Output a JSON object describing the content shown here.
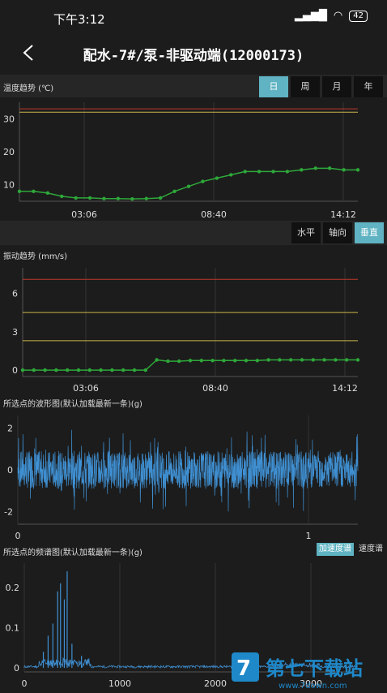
{
  "status_bar": {
    "time": "下午3:12",
    "battery": "42"
  },
  "header": {
    "title": "配水-7#/泵-非驱动端(12000173)"
  },
  "temperature": {
    "label": "温度趋势 (℃)",
    "period_tabs": [
      "日",
      "周",
      "月",
      "年"
    ],
    "active_tab": "日"
  },
  "vibration": {
    "direction_tabs": [
      "水平",
      "轴向",
      "垂直"
    ],
    "active_tab": "垂直",
    "label": "振动趋势 (mm/s)"
  },
  "waveform": {
    "label": "所选点的波形图(默认加载最新一条)(g)"
  },
  "spectrum": {
    "label": "所选点的频谱图(默认加载最新一条)(g)",
    "tabs": [
      "加速度谱",
      "速度谱"
    ],
    "active_tab": "加速度谱"
  },
  "watermark": {
    "text": "第七下载站",
    "url": "www.7down.com"
  },
  "colors": {
    "accent": "#5fb3c2",
    "series_green": "#2ea83a",
    "alarm_red": "#c0392b",
    "alarm_yellow": "#c9b44a",
    "wave_blue": "#3f8fd1"
  },
  "chart_data": [
    {
      "type": "line",
      "name": "temperature-trend",
      "x_tick_labels": [
        "03:06",
        "08:40",
        "14:12"
      ],
      "y_ticks": [
        10,
        20,
        30
      ],
      "ylim": [
        5,
        35
      ],
      "thresholds": [
        33,
        32
      ],
      "series": [
        {
          "values": [
            8,
            8,
            7.5,
            6.5,
            6,
            6,
            5.8,
            5.8,
            5.7,
            5.8,
            6,
            8,
            9.5,
            11,
            12,
            13,
            14,
            14,
            14,
            14,
            14.5,
            15,
            15,
            14.5,
            14.5
          ]
        }
      ]
    },
    {
      "type": "line",
      "name": "vibration-trend",
      "x_tick_labels": [
        "03:06",
        "08:40",
        "14:12"
      ],
      "y_ticks": [
        0,
        3,
        6
      ],
      "ylim": [
        -0.5,
        8
      ],
      "thresholds": [
        7.1,
        4.5,
        2.3
      ],
      "series": [
        {
          "values": [
            0,
            0,
            0,
            0,
            0,
            0,
            0,
            0,
            0,
            0,
            0,
            0,
            0.8,
            0.7,
            0.7,
            0.75,
            0.75,
            0.75,
            0.75,
            0.75,
            0.75,
            0.75,
            0.8,
            0.8,
            0.8,
            0.8,
            0.8,
            0.8,
            0.8,
            0.8,
            0.8
          ]
        }
      ]
    },
    {
      "type": "line",
      "name": "waveform",
      "x_tick_labels": [
        "0",
        "1"
      ],
      "y_ticks": [
        -2,
        0,
        2
      ],
      "ylim": [
        -2.6,
        2.6
      ],
      "amplitude": 2.0
    },
    {
      "type": "line",
      "name": "spectrum",
      "x_tick_labels": [
        "0",
        "1000",
        "2000",
        "3000"
      ],
      "y_ticks": [
        0,
        0.1,
        0.2
      ],
      "ylim": [
        -0.01,
        0.26
      ],
      "peaks": [
        [
          350,
          0.19
        ],
        [
          380,
          0.21
        ],
        [
          420,
          0.17
        ],
        [
          450,
          0.24
        ],
        [
          300,
          0.11
        ],
        [
          250,
          0.08
        ],
        [
          500,
          0.06
        ],
        [
          600,
          0.03
        ],
        [
          200,
          0.04
        ]
      ]
    }
  ]
}
